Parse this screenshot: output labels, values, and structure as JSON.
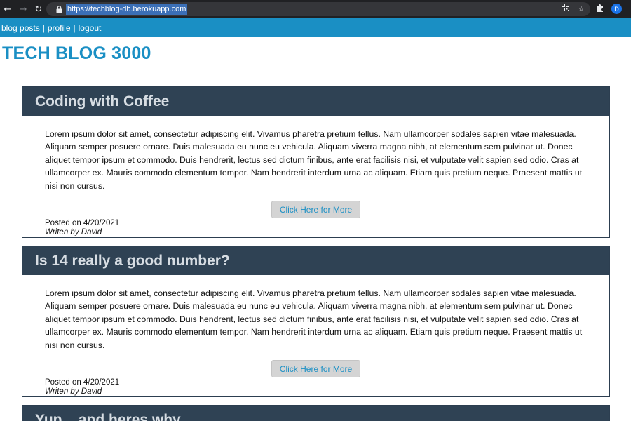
{
  "browser": {
    "url": "https://techblog-db.herokuapp.com",
    "avatar_initial": "D",
    "icons": [
      "back-arrow-icon",
      "forward-arrow-icon",
      "reload-icon",
      "lock-icon",
      "qr-code-icon",
      "star-icon",
      "extensions-puzzle-icon"
    ]
  },
  "nav": {
    "blog_posts": "blog posts",
    "profile": "profile",
    "logout": "logout",
    "separator": "|"
  },
  "site_title": "TECH BLOG 3000",
  "posts": [
    {
      "title": "Coding with Coffee",
      "body": "Lorem ipsum dolor sit amet, consectetur adipiscing elit. Vivamus pharetra pretium tellus. Nam ullamcorper sodales sapien vitae malesuada. Aliquam semper posuere ornare. Duis malesuada eu nunc eu vehicula. Aliquam viverra magna nibh, at elementum sem pulvinar ut. Donec aliquet tempor ipsum et commodo. Duis hendrerit, lectus sed dictum finibus, ante erat facilisis nisi, et vulputate velit sapien sed odio. Cras at ullamcorper ex. Mauris commodo elementum tempor. Nam hendrerit interdum urna ac aliquam. Etiam quis pretium neque. Praesent mattis ut nisi non cursus.",
      "button": "Click Here for More",
      "posted": "Posted on 4/20/2021",
      "author": "Writen by David"
    },
    {
      "title": "Is 14 really a good number?",
      "body": "Lorem ipsum dolor sit amet, consectetur adipiscing elit. Vivamus pharetra pretium tellus. Nam ullamcorper sodales sapien vitae malesuada. Aliquam semper posuere ornare. Duis malesuada eu nunc eu vehicula. Aliquam viverra magna nibh, at elementum sem pulvinar ut. Donec aliquet tempor ipsum et commodo. Duis hendrerit, lectus sed dictum finibus, ante erat facilisis nisi, et vulputate velit sapien sed odio. Cras at ullamcorper ex. Mauris commodo elementum tempor. Nam hendrerit interdum urna ac aliquam. Etiam quis pretium neque. Praesent mattis ut nisi non cursus.",
      "button": "Click Here for More",
      "posted": "Posted on 4/20/2021",
      "author": "Writen by David"
    },
    {
      "title": "Yup... and heres why"
    }
  ],
  "colors": {
    "brand_blue": "#1a8fc4",
    "post_header": "#2f4254",
    "post_title": "#d7dde3",
    "button_bg": "#d4d4d4"
  }
}
